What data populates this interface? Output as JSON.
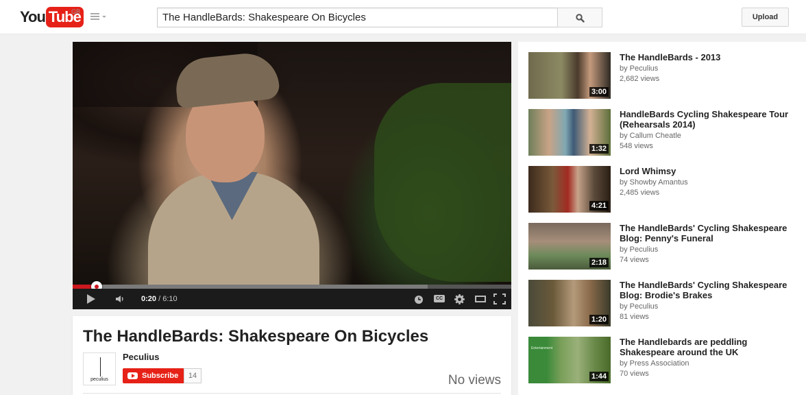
{
  "masthead": {
    "logo_you": "You",
    "logo_tube": "Tube",
    "region": "GB",
    "search_value": "The HandleBards: Shakespeare On Bicycles",
    "upload_label": "Upload",
    "icons": [
      "guide-menu-icon",
      "search-icon"
    ]
  },
  "player": {
    "current_time": "0:20",
    "duration": "6:10",
    "time_separator": " / ",
    "played_fraction": 0.054,
    "loaded_fraction": 0.81,
    "cc_label": "CC",
    "icons": [
      "play-icon",
      "volume-icon",
      "watch-later-icon",
      "captions-icon",
      "settings-gear-icon",
      "player-size-icon",
      "fullscreen-icon"
    ],
    "colors": {
      "progress_played": "#cc181e",
      "controls_bg": "#1b1b1b"
    }
  },
  "watch": {
    "title": "The HandleBards: Shakespeare On Bicycles",
    "owner": "Peculius",
    "avatar_label": "peculius",
    "subscribe_label": "Subscribe",
    "subscriber_count": "14",
    "views": "No views"
  },
  "sidebar": {
    "items": [
      {
        "title_line1": "The HandleBards - 2013",
        "title_line2": "",
        "channel": "by Peculius",
        "views": "2,682 views",
        "duration": "3:00"
      },
      {
        "title_line1": "HandleBards Cycling Shakespeare Tour",
        "title_line2": "(Rehearsals 2014)",
        "channel": "by Callum Cheatle",
        "views": "548 views",
        "duration": "1:32"
      },
      {
        "title_line1": "Lord Whimsy",
        "title_line2": "",
        "channel": "by Showby Amantus",
        "views": "2,485 views",
        "duration": "4:21"
      },
      {
        "title_line1": "The HandleBards' Cycling Shakespeare",
        "title_line2": "Blog: Penny's Funeral",
        "channel": "by Peculius",
        "views": "74 views",
        "duration": "2:18"
      },
      {
        "title_line1": "The HandleBards' Cycling Shakespeare",
        "title_line2": "Blog: Brodie's Brakes",
        "channel": "by Peculius",
        "views": "81 views",
        "duration": "1:20"
      },
      {
        "title_line1": "The Handlebards are peddling",
        "title_line2": "Shakespeare around the UK",
        "channel": "by Press Association",
        "views": "70 views",
        "duration": "1:44",
        "thumb_text": "Entertainment"
      }
    ]
  },
  "colors": {
    "brand_red": "#e62117",
    "page_bg": "#f1f1f1"
  }
}
